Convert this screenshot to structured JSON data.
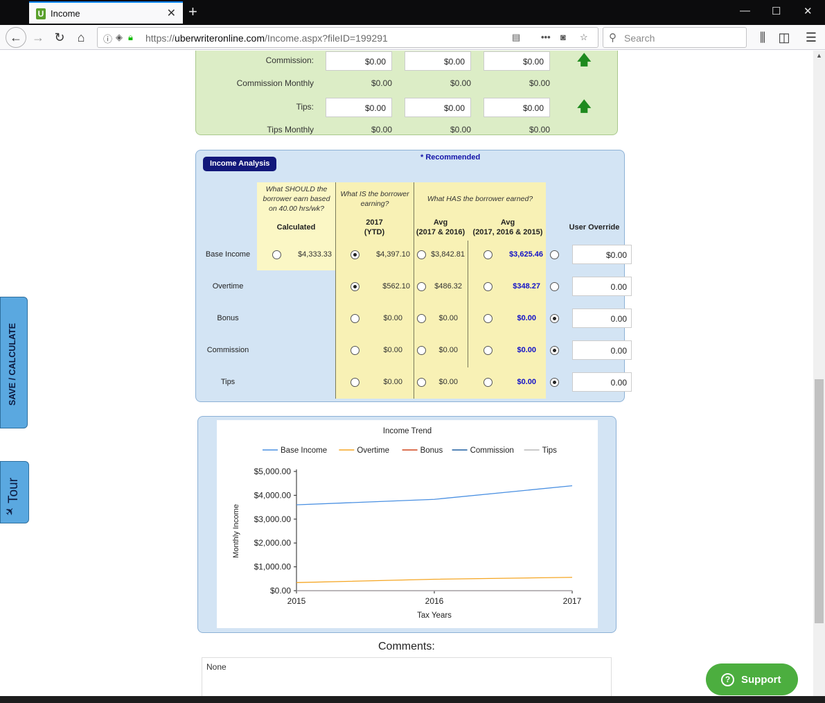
{
  "browser": {
    "tab_title": "Income",
    "favicon_letter": "U",
    "url_prefix": "https://",
    "url_host": "uberwriteronline.com",
    "url_path": "/Income.aspx?fileID=199291",
    "search_placeholder": "Search"
  },
  "green_section": {
    "rows": [
      {
        "label": "Commission:",
        "values": [
          "$0.00",
          "$0.00",
          "$0.00"
        ],
        "editable": true
      },
      {
        "label": "Commission Monthly",
        "values": [
          "$0.00",
          "$0.00",
          "$0.00"
        ],
        "editable": false
      },
      {
        "label": "Tips:",
        "values": [
          "$0.00",
          "$0.00",
          "$0.00"
        ],
        "editable": true
      },
      {
        "label": "Tips Monthly",
        "values": [
          "$0.00",
          "$0.00",
          "$0.00"
        ],
        "editable": false
      }
    ]
  },
  "analysis": {
    "title": "Income Analysis",
    "recommended": "* Recommended",
    "q_should": "What SHOULD the borrower earn based on 40.00 hrs/wk?",
    "q_is": "What IS the borrower earning?",
    "q_has": "What HAS the borrower earned?",
    "h_calc": "Calculated",
    "h_ytd_1": "2017",
    "h_ytd_2": "(YTD)",
    "h_avg2_1": "Avg",
    "h_avg2_2": "(2017 & 2016)",
    "h_avg3_1": "Avg",
    "h_avg3_2": "(2017, 2016 & 2015)",
    "h_override": "User Override",
    "rows": [
      {
        "label": "Base Income",
        "calc": "$4,333.33",
        "ytd": "$4,397.10",
        "avg2": "$3,842.81",
        "avg3": "$3,625.46",
        "override": "$0.00"
      },
      {
        "label": "Overtime",
        "calc": "",
        "ytd": "$562.10",
        "avg2": "$486.32",
        "avg3": "$348.27",
        "override": "0.00"
      },
      {
        "label": "Bonus",
        "calc": "",
        "ytd": "$0.00",
        "avg2": "$0.00",
        "avg3": "$0.00",
        "override": "0.00"
      },
      {
        "label": "Commission",
        "calc": "",
        "ytd": "$0.00",
        "avg2": "$0.00",
        "avg3": "$0.00",
        "override": "0.00"
      },
      {
        "label": "Tips",
        "calc": "",
        "ytd": "$0.00",
        "avg2": "$0.00",
        "avg3": "$0.00",
        "override": "0.00"
      }
    ],
    "selected": [
      "ytd",
      "ytd",
      "override",
      "override",
      "override"
    ]
  },
  "chart_data": {
    "type": "line",
    "title": "Income Trend",
    "xlabel": "Tax Years",
    "ylabel": "Monthly Income",
    "x": [
      2015,
      2016,
      2017
    ],
    "ylim": [
      0,
      5000
    ],
    "yticks": [
      "$0.00",
      "$1,000.00",
      "$2,000.00",
      "$3,000.00",
      "$4,000.00",
      "$5,000.00"
    ],
    "legend_position": "top",
    "series": [
      {
        "name": "Base Income",
        "color": "#4a90e2",
        "values": [
          3600,
          3830,
          4400
        ]
      },
      {
        "name": "Overtime",
        "color": "#f5a623",
        "values": [
          340,
          480,
          560
        ]
      },
      {
        "name": "Bonus",
        "color": "#d0441a",
        "values": [
          0,
          0,
          0
        ]
      },
      {
        "name": "Commission",
        "color": "#1f5fa0",
        "values": [
          0,
          0,
          0
        ]
      },
      {
        "name": "Tips",
        "color": "#b8b8b8",
        "values": [
          0,
          0,
          0
        ]
      }
    ]
  },
  "comments": {
    "title": "Comments:",
    "text": "None"
  },
  "side": {
    "save": "SAVE / CALCULATE",
    "tour": "Tour"
  },
  "support": "Support"
}
